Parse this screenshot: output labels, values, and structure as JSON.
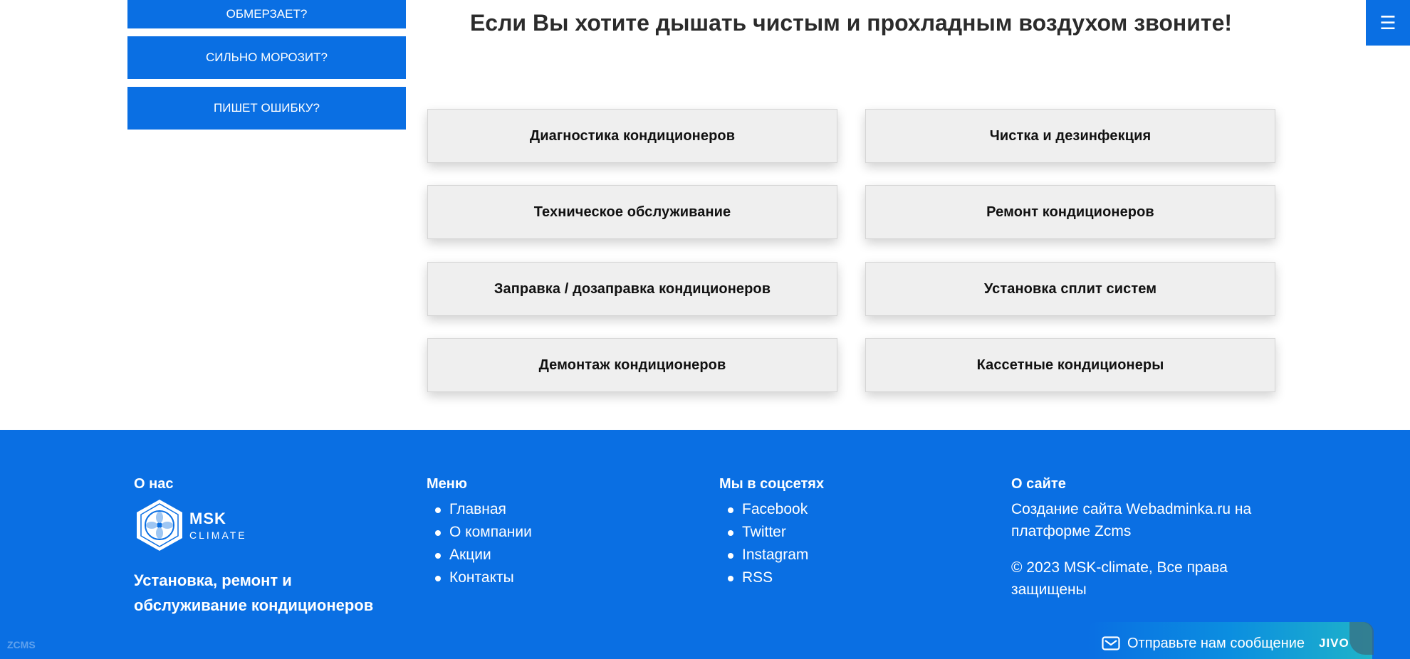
{
  "side_buttons": [
    {
      "label": "ОБМЕРЗАЕТ?"
    },
    {
      "label": "СИЛЬНО МОРОЗИТ?"
    },
    {
      "label": "ПИШЕТ ОШИБКУ?"
    }
  ],
  "menu_icon": "hamburger-icon",
  "headline": "Если Вы хотите дышать чистым и прохладным воздухом звоните!",
  "services": [
    {
      "label": "Диагностика кондиционеров"
    },
    {
      "label": "Чистка и дезинфекция"
    },
    {
      "label": "Техническое обслуживание"
    },
    {
      "label": "Ремонт кондиционеров"
    },
    {
      "label": "Заправка / дозаправка кондиционеров"
    },
    {
      "label": "Установка сплит систем"
    },
    {
      "label": "Демонтаж кондиционеров"
    },
    {
      "label": "Кассетные кондиционеры"
    }
  ],
  "footer": {
    "about": {
      "title": "О нас",
      "logo_msk": "MSK",
      "logo_climate": "CLIMATE",
      "tagline": "Установка, ремонт и обслуживание кондиционеров"
    },
    "menu": {
      "title": "Меню",
      "items": [
        "Главная",
        "О компании",
        "Акции",
        "Контакты"
      ]
    },
    "social": {
      "title": "Мы в соцсетях",
      "items": [
        "Facebook",
        "Twitter",
        "Instagram",
        "RSS"
      ]
    },
    "site": {
      "title": "О сайте",
      "credit": "Создание сайта Webadminka.ru на платформе Zcms",
      "copyright": "© 2023 MSK-climate, Все права защищены"
    },
    "zcms_mark": "ZCMS"
  },
  "chat_widget": {
    "label": "Отправьте нам сообщение",
    "brand": "JIVO"
  },
  "colors": {
    "primary": "#0a6fe3",
    "service_bg": "#efefef"
  }
}
